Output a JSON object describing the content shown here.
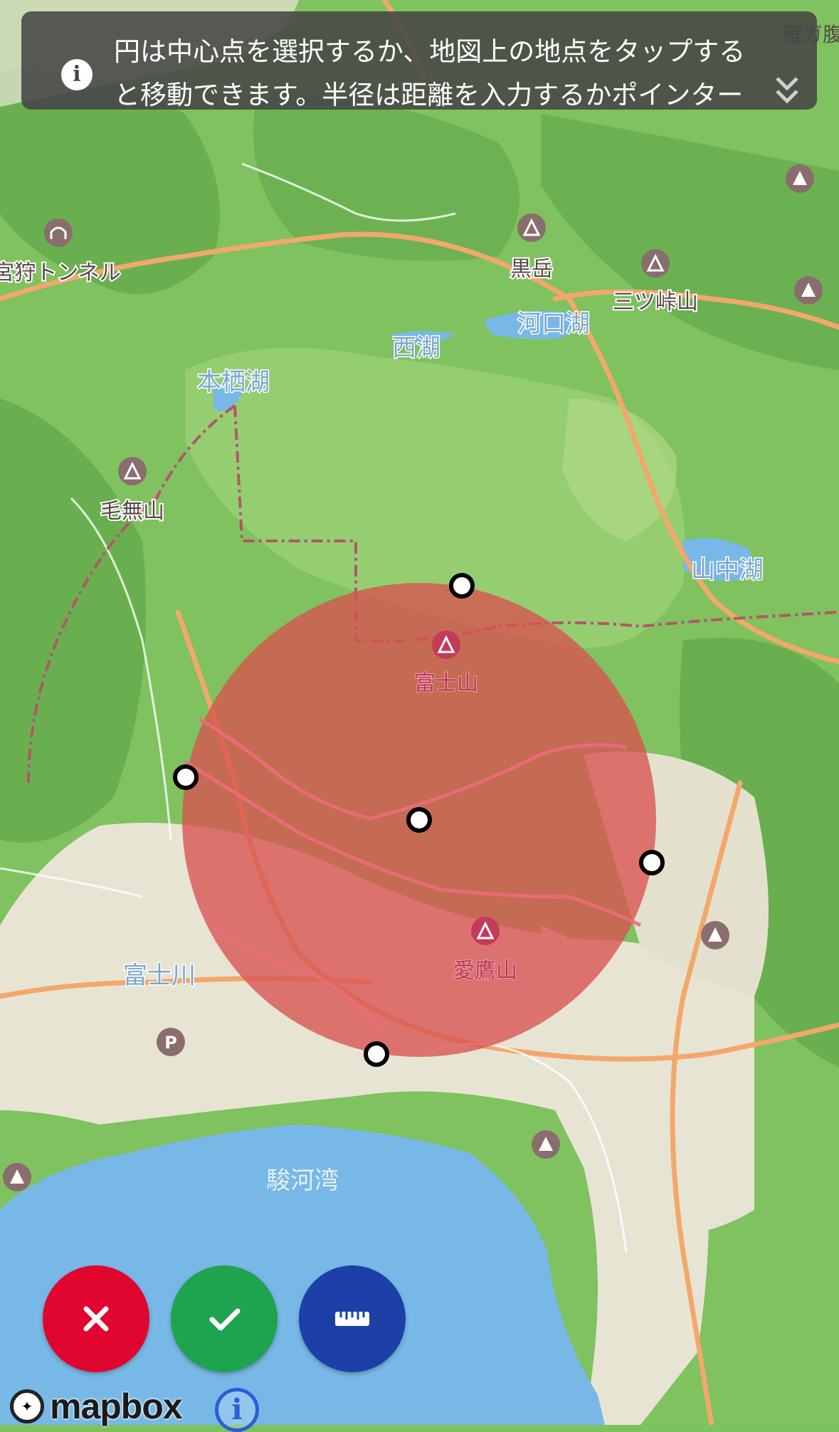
{
  "banner": {
    "line1": "円は中心点を選択するか、地図上の地点をタップする",
    "line2": "と移動できます。半径は距離を入力するかポインター",
    "peek": "雁ガ腹"
  },
  "map_labels": {
    "kurodake": "黒岳",
    "mitsutoge": "三ツ峠山",
    "kawaguchiko": "河口湖",
    "saiko": "西湖",
    "motosuko": "本栖湖",
    "kenashiyama": "毛無山",
    "yamanakako": "山中湖",
    "fujisan": "富士山",
    "ashitakayama": "愛鷹山",
    "fujikawa": "富士川",
    "surugawan": "駿河湾",
    "tunnel": "宮狩トンネル"
  },
  "buttons": {
    "cancel": "cancel",
    "confirm": "confirm",
    "measure": "measure"
  },
  "colors": {
    "circle": "#d9524f",
    "cancel": "#e0062f",
    "confirm": "#1ea44f",
    "measure": "#1c3fa8",
    "water": "#78b8e6",
    "land": "#7cc25f"
  },
  "logo": {
    "word": "mapbox"
  },
  "attribution": "i"
}
